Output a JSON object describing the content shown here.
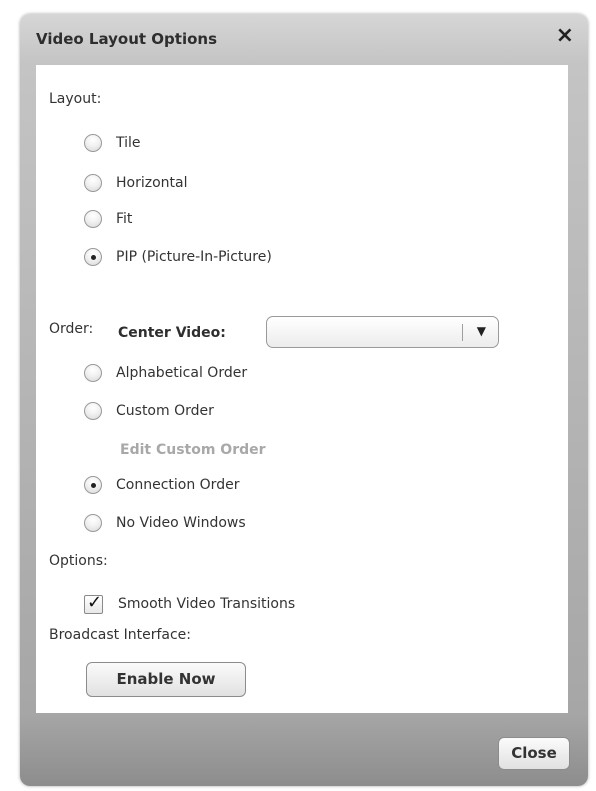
{
  "dialog": {
    "title": "Video Layout Options",
    "close_icon": "×",
    "close_button": "Close"
  },
  "layout": {
    "label": "Layout:",
    "options": [
      {
        "label": "Tile",
        "checked": false
      },
      {
        "label": "Horizontal",
        "checked": false
      },
      {
        "label": "Fit",
        "checked": false
      },
      {
        "label": "PIP (Picture-In-Picture)",
        "checked": true
      }
    ],
    "center_video": {
      "label": "Center Video:",
      "value": "",
      "dropdown_icon": "▼"
    }
  },
  "order": {
    "label": "Order:",
    "options": [
      {
        "label": "Alphabetical Order",
        "checked": false
      },
      {
        "label": "Custom Order",
        "checked": false
      },
      {
        "label": "Connection Order",
        "checked": true
      },
      {
        "label": "No Video Windows",
        "checked": false
      }
    ],
    "edit_custom_order": "Edit Custom Order"
  },
  "options": {
    "label": "Options:",
    "smooth_transitions": {
      "label": "Smooth Video Transitions",
      "checked": true,
      "check_glyph": "✓"
    }
  },
  "broadcast": {
    "label": "Broadcast Interface:",
    "button": "Enable Now"
  }
}
